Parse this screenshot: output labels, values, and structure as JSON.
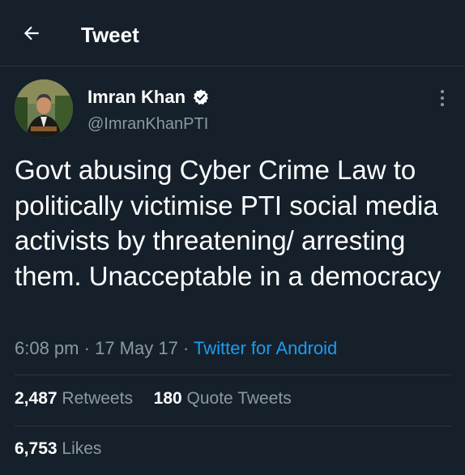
{
  "header": {
    "title": "Tweet",
    "back_icon": "arrow-left-icon"
  },
  "author": {
    "name": "Imran Khan",
    "handle": "@ImranKhanPTI",
    "verified_icon": "verified-badge-icon"
  },
  "tweet": {
    "text": "Govt abusing Cyber Crime Law to politically victimise PTI social media activists by threatening/ arresting them. Unacceptable in a democracy",
    "time": "6:08 pm",
    "date": "17 May 17",
    "source": "Twitter for Android"
  },
  "stats": {
    "retweets_count": "2,487",
    "retweets_label": "Retweets",
    "quotes_count": "180",
    "quotes_label": "Quote Tweets",
    "likes_count": "6,753",
    "likes_label": "Likes"
  },
  "colors": {
    "background": "#15202b",
    "link": "#1d9bf0",
    "secondary_text": "#8b98a5"
  }
}
